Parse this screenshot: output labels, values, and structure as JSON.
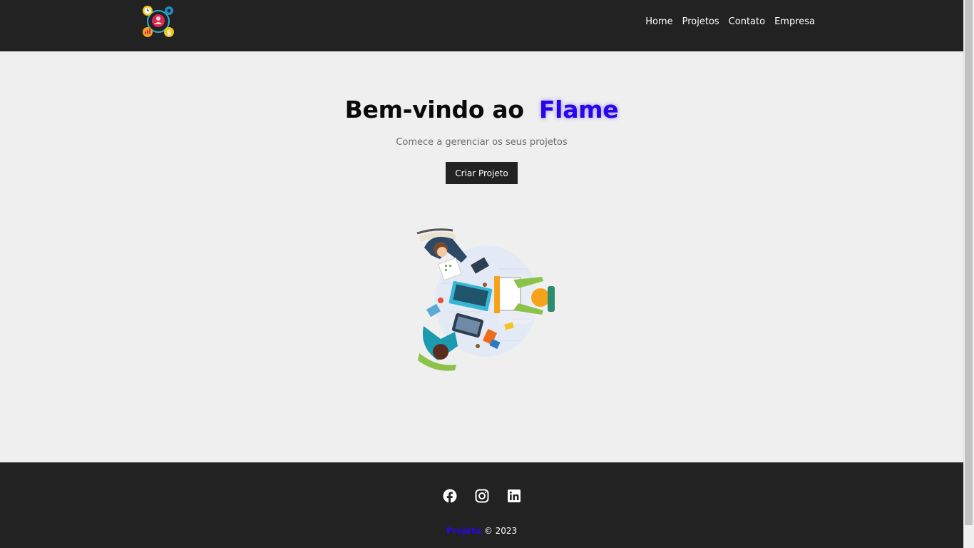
{
  "nav": {
    "logo_alt": "Flame",
    "links": [
      "Home",
      "Projetos",
      "Contato",
      "Empresa"
    ]
  },
  "hero": {
    "title_prefix": "Bem-vindo ao",
    "title_brand": "Flame",
    "subtitle": "Comece a gerenciar os seus projetos",
    "cta_label": "Criar Projeto",
    "illustration": "team-meeting-illustration"
  },
  "footer": {
    "social_icons": [
      "facebook-icon",
      "instagram-icon",
      "linkedin-icon"
    ],
    "copyright_brand": "Projeto",
    "copyright_text": "© 2023"
  },
  "colors": {
    "nav_bg": "#222222",
    "page_bg": "#efefef",
    "brand": "#2a05e6",
    "button_bg": "#222222"
  }
}
